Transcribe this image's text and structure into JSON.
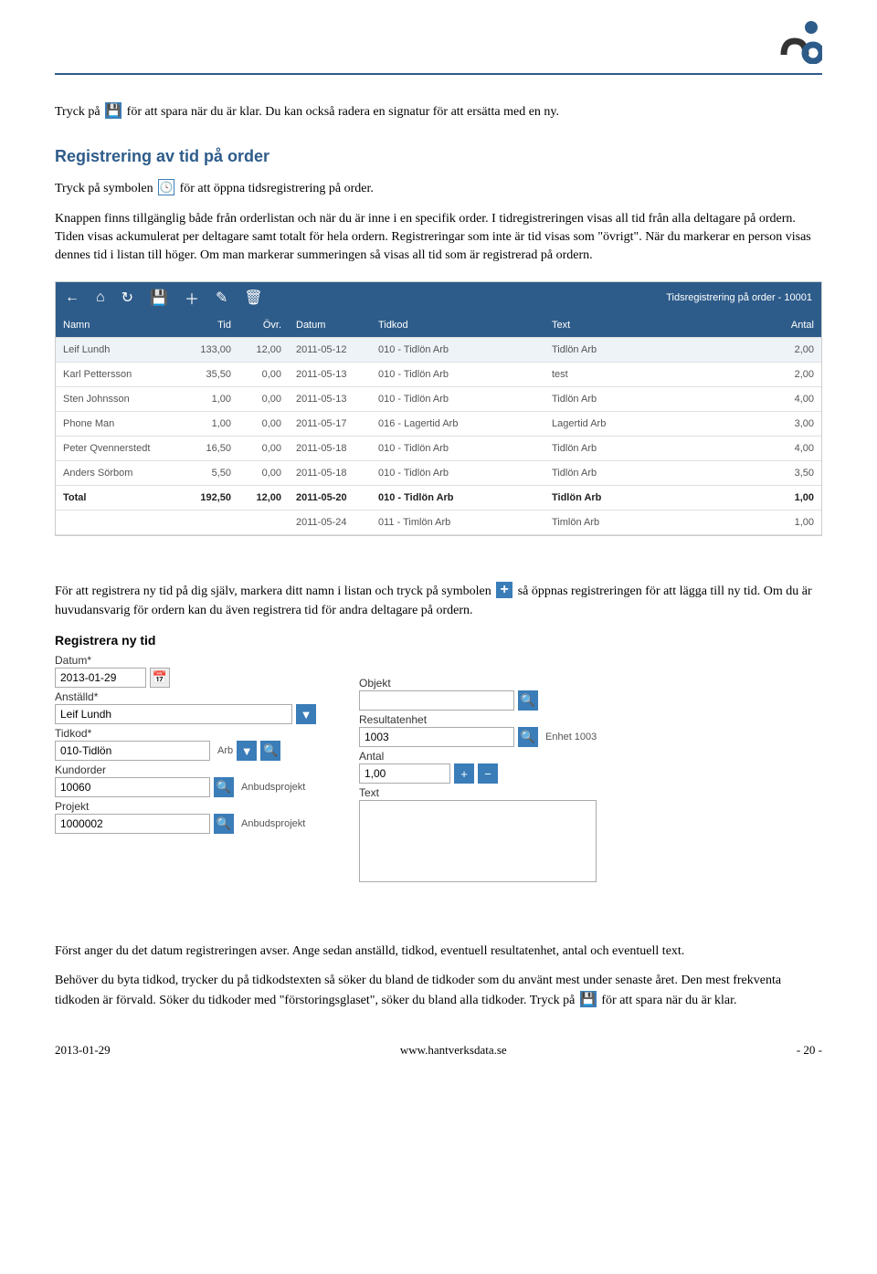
{
  "doc": {
    "para1a": "Tryck på ",
    "para1b": " för att spara när du är klar. Du kan också radera en signatur för att ersätta med en ny.",
    "heading1": "Registrering av tid på order",
    "para2a": "Tryck på symbolen ",
    "para2b": " för att öppna tidsregistrering på order.",
    "para3": "Knappen finns tillgänglig både från orderlistan och när du är inne i en specifik order. I tidregistreringen visas all tid från alla deltagare på ordern. Tiden visas ackumulerat per deltagare samt totalt för hela ordern. Registreringar som inte är tid visas som \"övrigt\". När du markerar en person visas dennes tid i listan till höger. Om man markerar summeringen så visas all tid som är registrerad på ordern.",
    "para4a": "För att registrera ny tid på dig själv, markera ditt namn i listan och tryck på symbolen ",
    "para4b": " så öppnas registreringen för att lägga till ny tid. Om du är huvudansvarig för ordern kan du även registrera tid för andra deltagare på ordern.",
    "para5": "Först anger du det datum registreringen avser. Ange sedan anställd, tidkod, eventuell resultatenhet, antal och eventuell text.",
    "para6a": "Behöver du byta tidkod, trycker du på tidkodstexten så söker du bland de tidkoder som du använt mest under senaste året. Den mest frekventa tidkoden är förvald. Söker du tidkoder med \"förstoringsglaset\", söker du bland alla tidkoder. Tryck på ",
    "para6b": " för att spara när du är klar."
  },
  "table": {
    "title": "Tidsregistrering på order - 10001",
    "headers": {
      "namn": "Namn",
      "tid": "Tid",
      "ovr": "Övr.",
      "datum": "Datum",
      "tidkod": "Tidkod",
      "text": "Text",
      "antal": "Antal"
    },
    "left": [
      {
        "namn": "Leif Lundh",
        "tid": "133,00",
        "ovr": "12,00",
        "selected": true
      },
      {
        "namn": "Karl Pettersson",
        "tid": "35,50",
        "ovr": "0,00"
      },
      {
        "namn": "Sten Johnsson",
        "tid": "1,00",
        "ovr": "0,00"
      },
      {
        "namn": "Phone Man",
        "tid": "1,00",
        "ovr": "0,00"
      },
      {
        "namn": "Peter Qvennerstedt",
        "tid": "16,50",
        "ovr": "0,00"
      },
      {
        "namn": "Anders Sörbom",
        "tid": "5,50",
        "ovr": "0,00"
      },
      {
        "namn": "Total",
        "tid": "192,50",
        "ovr": "12,00",
        "total": true
      }
    ],
    "right": [
      {
        "datum": "2011-05-12",
        "tidkod": "010 - Tidlön Arb",
        "text": "Tidlön Arb",
        "antal": "2,00"
      },
      {
        "datum": "2011-05-13",
        "tidkod": "010 - Tidlön Arb",
        "text": "test",
        "antal": "2,00"
      },
      {
        "datum": "2011-05-13",
        "tidkod": "010 - Tidlön Arb",
        "text": "Tidlön Arb",
        "antal": "4,00"
      },
      {
        "datum": "2011-05-17",
        "tidkod": "016 - Lagertid Arb",
        "text": "Lagertid Arb",
        "antal": "3,00"
      },
      {
        "datum": "2011-05-18",
        "tidkod": "010 - Tidlön Arb",
        "text": "Tidlön Arb",
        "antal": "4,00"
      },
      {
        "datum": "2011-05-18",
        "tidkod": "010 - Tidlön Arb",
        "text": "Tidlön Arb",
        "antal": "3,50"
      },
      {
        "datum": "2011-05-20",
        "tidkod": "010 - Tidlön Arb",
        "text": "Tidlön Arb",
        "antal": "1,00"
      },
      {
        "datum": "2011-05-24",
        "tidkod": "011 - Timlön Arb",
        "text": "Timlön Arb",
        "antal": "1,00"
      }
    ]
  },
  "form": {
    "title": "Registrera ny tid",
    "labels": {
      "datum": "Datum*",
      "anstalld": "Anställd*",
      "tidkod": "Tidkod*",
      "kundorder": "Kundorder",
      "projekt": "Projekt",
      "objekt": "Objekt",
      "resultatenhet": "Resultatenhet",
      "antal": "Antal",
      "text": "Text",
      "anbud": "Anbudsprojekt",
      "enhet": "Enhet 1003",
      "arb": "Arb"
    },
    "values": {
      "datum": "2013-01-29",
      "anstalld": "Leif Lundh",
      "tidkod": "010-Tidlön",
      "kundorder": "10060",
      "projekt": "1000002",
      "objekt": "",
      "resultatenhet": "1003",
      "antal": "1,00",
      "text": ""
    }
  },
  "footer": {
    "left": "2013-01-29",
    "center": "www.hantverksdata.se",
    "right": "- 20 -"
  }
}
